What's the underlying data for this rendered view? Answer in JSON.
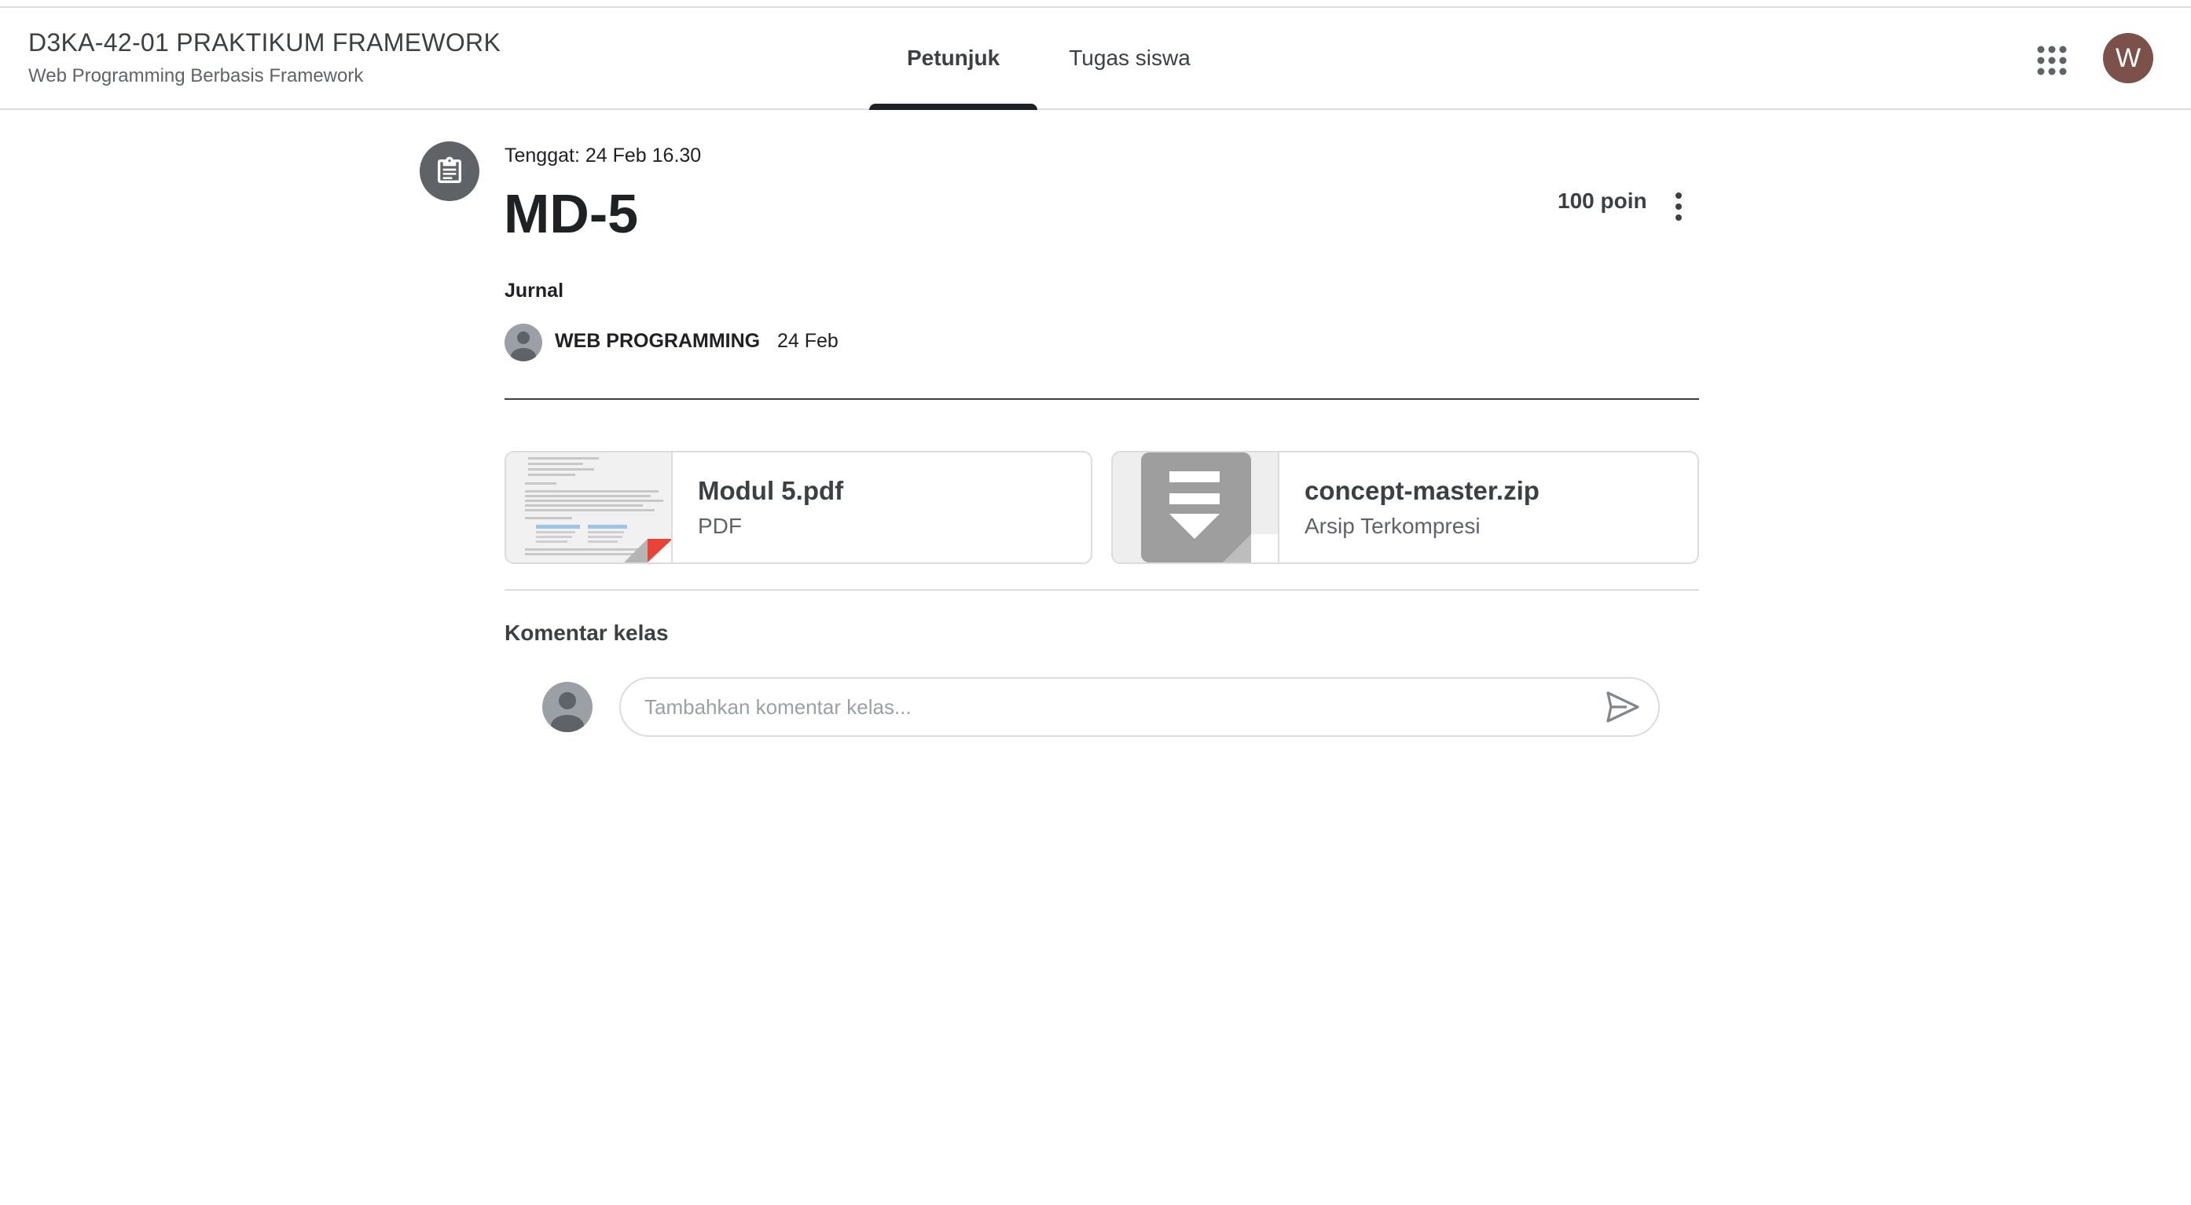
{
  "header": {
    "course_title": "D3KA-42-01 PRAKTIKUM FRAMEWORK",
    "course_subtitle": "Web Programming Berbasis Framework",
    "tabs": [
      {
        "label": "Petunjuk",
        "active": true
      },
      {
        "label": "Tugas siswa",
        "active": false
      }
    ],
    "apps_icon": "apps-grid-icon",
    "account_initial": "W",
    "account_color": "#7c5149"
  },
  "assignment": {
    "icon": "assignment-icon",
    "due": "Tenggat: 24 Feb 16.30",
    "title": "MD-5",
    "points": "100 poin",
    "topic": "Jurnal",
    "poster_name": "WEB PROGRAMMING",
    "posted_date": "24 Feb"
  },
  "attachments": [
    {
      "name": "Modul 5.pdf",
      "type": "PDF",
      "icon": "pdf-thumbnail"
    },
    {
      "name": "concept-master.zip",
      "type": "Arsip Terkompresi",
      "icon": "zip-archive-icon"
    }
  ],
  "comments": {
    "title": "Komentar kelas",
    "placeholder": "Tambahkan komentar kelas...",
    "send_icon": "send-icon"
  }
}
